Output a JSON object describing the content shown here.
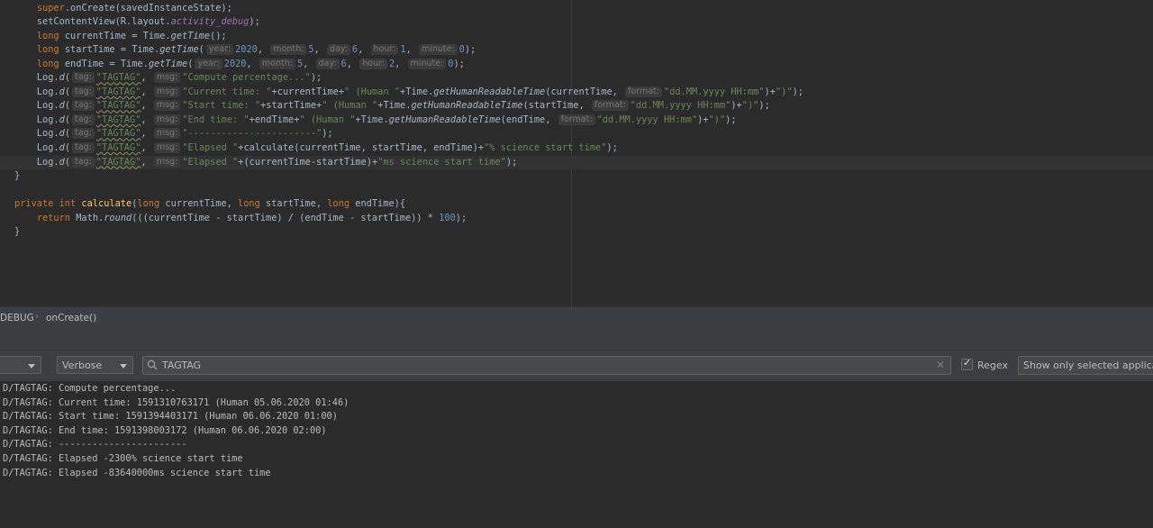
{
  "editor": {
    "lines": [
      [
        {
          "t": "    "
        },
        {
          "t": "super",
          "c": "t-kw"
        },
        {
          "t": ".onCreate(savedInstanceState);"
        }
      ],
      [
        {
          "t": "    setContentView(R.layout."
        },
        {
          "t": "activity_debug",
          "c": "t-field"
        },
        {
          "t": ");"
        }
      ],
      [
        {
          "t": "    "
        },
        {
          "t": "long",
          "c": "t-kw"
        },
        {
          "t": " currentTime = Time."
        },
        {
          "t": "getTime",
          "c": "t-ital"
        },
        {
          "t": "();"
        }
      ],
      [
        {
          "t": "    "
        },
        {
          "t": "long",
          "c": "t-kw"
        },
        {
          "t": " startTime = Time."
        },
        {
          "t": "getTime",
          "c": "t-ital"
        },
        {
          "t": "("
        },
        {
          "h": "year:"
        },
        {
          "t": "2020",
          "c": "t-num"
        },
        {
          "t": ", "
        },
        {
          "h": "month:"
        },
        {
          "t": "5",
          "c": "t-num"
        },
        {
          "t": ", "
        },
        {
          "h": "day:"
        },
        {
          "t": "6",
          "c": "t-num"
        },
        {
          "t": ", "
        },
        {
          "h": "hour:"
        },
        {
          "t": "1",
          "c": "t-num"
        },
        {
          "t": ", "
        },
        {
          "h": "minute:"
        },
        {
          "t": "0",
          "c": "t-num"
        },
        {
          "t": ");"
        }
      ],
      [
        {
          "t": "    "
        },
        {
          "t": "long",
          "c": "t-kw"
        },
        {
          "t": " endTime = Time."
        },
        {
          "t": "getTime",
          "c": "t-ital"
        },
        {
          "t": "("
        },
        {
          "h": "year:"
        },
        {
          "t": "2020",
          "c": "t-num"
        },
        {
          "t": ", "
        },
        {
          "h": "month:"
        },
        {
          "t": "5",
          "c": "t-num"
        },
        {
          "t": ", "
        },
        {
          "h": "day:"
        },
        {
          "t": "6",
          "c": "t-num"
        },
        {
          "t": ", "
        },
        {
          "h": "hour:"
        },
        {
          "t": "2",
          "c": "t-num"
        },
        {
          "t": ", "
        },
        {
          "h": "minute:"
        },
        {
          "t": "0",
          "c": "t-num"
        },
        {
          "t": ");"
        }
      ],
      [
        {
          "t": "    Log."
        },
        {
          "t": "d",
          "c": "t-ital"
        },
        {
          "t": "("
        },
        {
          "h": "tag:"
        },
        {
          "t": "\"TAGTAG\"",
          "c": "t-str t-under"
        },
        {
          "t": ", "
        },
        {
          "h": "msg:"
        },
        {
          "t": "\"Compute percentage...\"",
          "c": "t-str"
        },
        {
          "t": ");"
        }
      ],
      [
        {
          "t": "    Log."
        },
        {
          "t": "d",
          "c": "t-ital"
        },
        {
          "t": "("
        },
        {
          "h": "tag:"
        },
        {
          "t": "\"TAGTAG\"",
          "c": "t-str t-under"
        },
        {
          "t": ", "
        },
        {
          "h": "msg:"
        },
        {
          "t": "\"Current time: \"",
          "c": "t-str"
        },
        {
          "t": "+currentTime+"
        },
        {
          "t": "\" (Human \"",
          "c": "t-str"
        },
        {
          "t": "+Time."
        },
        {
          "t": "getHumanReadableTime",
          "c": "t-ital"
        },
        {
          "t": "(currentTime, "
        },
        {
          "h": "format:"
        },
        {
          "t": "\"dd.MM.yyyy HH:mm\"",
          "c": "t-str"
        },
        {
          "t": ")+"
        },
        {
          "t": "\")\"",
          "c": "t-str"
        },
        {
          "t": ");"
        }
      ],
      [
        {
          "t": "    Log."
        },
        {
          "t": "d",
          "c": "t-ital"
        },
        {
          "t": "("
        },
        {
          "h": "tag:"
        },
        {
          "t": "\"TAGTAG\"",
          "c": "t-str t-under"
        },
        {
          "t": ", "
        },
        {
          "h": "msg:"
        },
        {
          "t": "\"Start time: \"",
          "c": "t-str"
        },
        {
          "t": "+startTime+"
        },
        {
          "t": "\" (Human \"",
          "c": "t-str"
        },
        {
          "t": "+Time."
        },
        {
          "t": "getHumanReadableTime",
          "c": "t-ital"
        },
        {
          "t": "(startTime, "
        },
        {
          "h": "format:"
        },
        {
          "t": "\"dd.MM.yyyy HH:mm\"",
          "c": "t-str"
        },
        {
          "t": ")+"
        },
        {
          "t": "\")\"",
          "c": "t-str"
        },
        {
          "t": ");"
        }
      ],
      [
        {
          "t": "    Log."
        },
        {
          "t": "d",
          "c": "t-ital"
        },
        {
          "t": "("
        },
        {
          "h": "tag:"
        },
        {
          "t": "\"TAGTAG\"",
          "c": "t-str t-under"
        },
        {
          "t": ", "
        },
        {
          "h": "msg:"
        },
        {
          "t": "\"End time: \"",
          "c": "t-str"
        },
        {
          "t": "+endTime+"
        },
        {
          "t": "\" (Human \"",
          "c": "t-str"
        },
        {
          "t": "+Time."
        },
        {
          "t": "getHumanReadableTime",
          "c": "t-ital"
        },
        {
          "t": "(endTime, "
        },
        {
          "h": "format:"
        },
        {
          "t": "\"dd.MM.yyyy HH:mm\"",
          "c": "t-str"
        },
        {
          "t": ")+"
        },
        {
          "t": "\")\"",
          "c": "t-str"
        },
        {
          "t": ");"
        }
      ],
      [
        {
          "t": "    Log."
        },
        {
          "t": "d",
          "c": "t-ital"
        },
        {
          "t": "("
        },
        {
          "h": "tag:"
        },
        {
          "t": "\"TAGTAG\"",
          "c": "t-str t-under"
        },
        {
          "t": ", "
        },
        {
          "h": "msg:"
        },
        {
          "t": "\"-----------------------\"",
          "c": "t-str"
        },
        {
          "t": ");"
        }
      ],
      [
        {
          "t": "    Log."
        },
        {
          "t": "d",
          "c": "t-ital"
        },
        {
          "t": "("
        },
        {
          "h": "tag:"
        },
        {
          "t": "\"TAGTAG\"",
          "c": "t-str t-under"
        },
        {
          "t": ", "
        },
        {
          "h": "msg:"
        },
        {
          "t": "\"Elapsed \"",
          "c": "t-str"
        },
        {
          "t": "+calculate(currentTime, startTime, endTime)+"
        },
        {
          "t": "\"% science start time\"",
          "c": "t-str"
        },
        {
          "t": ");"
        }
      ],
      [
        {
          "t": "    Log."
        },
        {
          "t": "d",
          "c": "t-ital"
        },
        {
          "t": "("
        },
        {
          "h": "tag:"
        },
        {
          "t": "\"TAGTAG\"",
          "c": "t-str t-under"
        },
        {
          "t": ", "
        },
        {
          "h": "msg:"
        },
        {
          "t": "\"Elapsed \"",
          "c": "t-str"
        },
        {
          "t": "+(currentTime-startTime)+"
        },
        {
          "t": "\"ms science start time\"",
          "c": "t-str"
        },
        {
          "t": ");"
        }
      ],
      [
        {
          "t": "}"
        }
      ],
      [
        {
          "t": ""
        }
      ],
      [
        {
          "t": "private int ",
          "c": "t-kw"
        },
        {
          "t": "calculate",
          "c": "t-fn"
        },
        {
          "t": "("
        },
        {
          "t": "long",
          "c": "t-kw"
        },
        {
          "t": " currentTime, "
        },
        {
          "t": "long",
          "c": "t-kw"
        },
        {
          "t": " startTime, "
        },
        {
          "t": "long",
          "c": "t-kw"
        },
        {
          "t": " endTime){"
        }
      ],
      [
        {
          "t": "    "
        },
        {
          "t": "return",
          "c": "t-kw"
        },
        {
          "t": " Math."
        },
        {
          "t": "round",
          "c": "t-ital"
        },
        {
          "t": "(((currentTime - startTime) / (endTime - startTime)) * "
        },
        {
          "t": "100",
          "c": "t-num"
        },
        {
          "t": ");"
        }
      ],
      [
        {
          "t": "}"
        }
      ]
    ],
    "current_line_index": 11
  },
  "breadcrumb": {
    "items": [
      "DEBUG",
      "onCreate()"
    ]
  },
  "logcat": {
    "level_selected": "Verbose",
    "search_value": "TAGTAG",
    "regex_label": "Regex",
    "regex_checked": true,
    "filter_selected": "Show only selected application",
    "lines": [
      "D/TAGTAG: Compute percentage...",
      "D/TAGTAG: Current time: 1591310763171 (Human 05.06.2020 01:46)",
      "D/TAGTAG: Start time: 1591394403171 (Human 06.06.2020 01:00)",
      "D/TAGTAG: End time: 1591398003172 (Human 06.06.2020 02:00)",
      "D/TAGTAG: -----------------------",
      "D/TAGTAG: Elapsed -2300% science start time",
      "D/TAGTAG: Elapsed -83640000ms science start time"
    ]
  },
  "colors": {
    "background": "#2b2b2b",
    "toolbar": "#3c3f41",
    "keyword": "#cc7832",
    "string": "#6a8759",
    "number": "#6897bb",
    "field": "#9876aa",
    "function": "#ffc66d"
  }
}
